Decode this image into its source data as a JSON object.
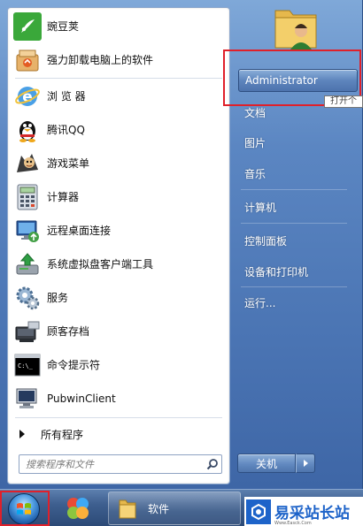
{
  "programs": [
    {
      "label": "豌豆荚",
      "icon": "wandoujia-icon"
    },
    {
      "label": "强力卸载电脑上的软件",
      "icon": "uninstaller-icon"
    },
    {
      "label": "浏 览 器",
      "icon": "ie-browser-icon"
    },
    {
      "label": "腾讯QQ",
      "icon": "qq-penguin-icon"
    },
    {
      "label": "游戏菜单",
      "icon": "game-menu-icon"
    },
    {
      "label": "计算器",
      "icon": "calculator-icon"
    },
    {
      "label": "远程桌面连接",
      "icon": "remote-desktop-icon"
    },
    {
      "label": "系统虚拟盘客户端工具",
      "icon": "virtual-disk-icon"
    },
    {
      "label": "服务",
      "icon": "services-gear-icon"
    },
    {
      "label": "顾客存档",
      "icon": "customer-archive-icon"
    },
    {
      "label": "命令提示符",
      "icon": "command-prompt-icon"
    },
    {
      "label": "PubwinClient",
      "icon": "pubwin-client-icon"
    }
  ],
  "all_programs_label": "所有程序",
  "search": {
    "placeholder": "搜索程序和文件"
  },
  "user": {
    "name": "Administrator",
    "tooltip": "打开个"
  },
  "places": [
    "文档",
    "图片",
    "音乐",
    "计算机",
    "控制面板",
    "设备和打印机",
    "运行..."
  ],
  "shutdown_label": "关机",
  "taskbar": {
    "folder_label": "软件"
  },
  "watermark": {
    "text": "易采站长站",
    "subtext": "Www.Easck.Com"
  },
  "colors": {
    "highlight_red": "#e0202a",
    "accent_blue": "#1d63c9"
  }
}
